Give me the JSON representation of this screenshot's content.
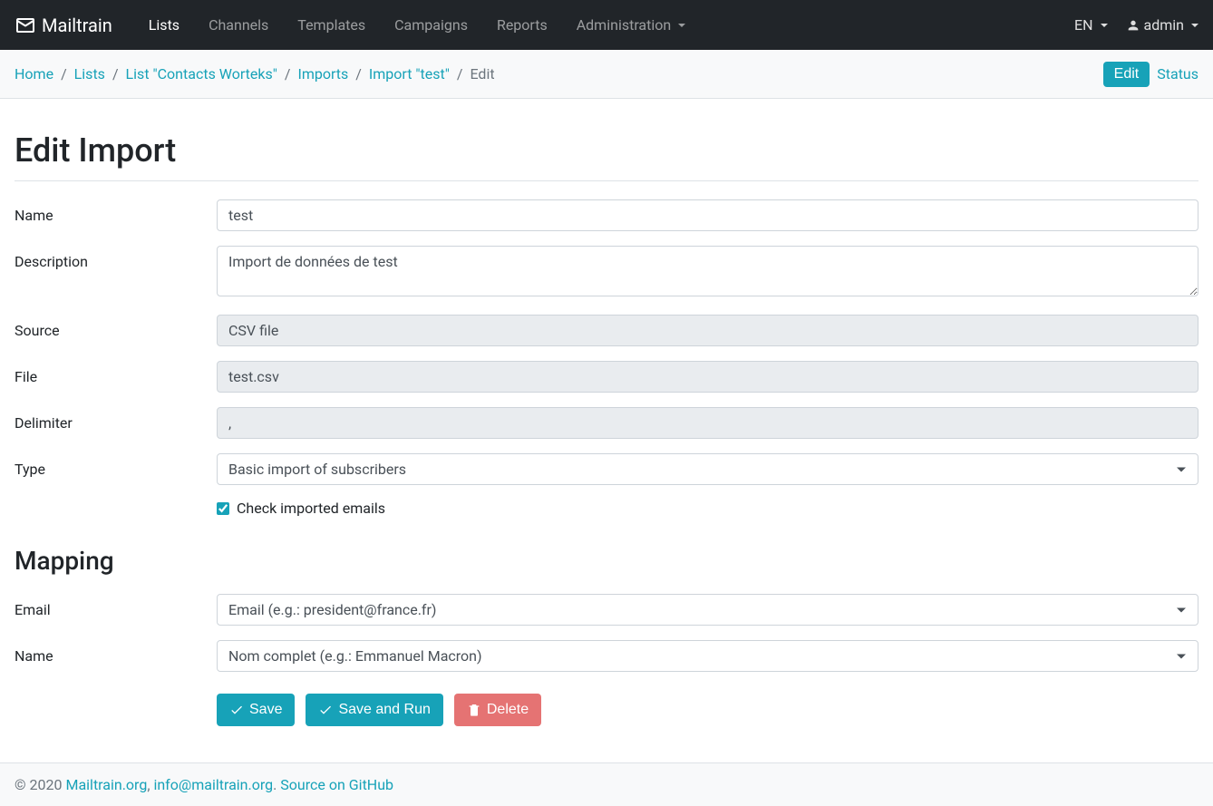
{
  "brand": "Mailtrain",
  "nav": {
    "items": [
      {
        "label": "Lists",
        "active": true
      },
      {
        "label": "Channels"
      },
      {
        "label": "Templates"
      },
      {
        "label": "Campaigns"
      },
      {
        "label": "Reports"
      },
      {
        "label": "Administration",
        "dropdown": true
      }
    ],
    "right": {
      "lang": "EN",
      "user": "admin"
    }
  },
  "breadcrumb": [
    {
      "label": "Home",
      "link": true
    },
    {
      "label": "Lists",
      "link": true
    },
    {
      "label": "List \"Contacts Worteks\"",
      "link": true
    },
    {
      "label": "Imports",
      "link": true
    },
    {
      "label": "Import \"test\"",
      "link": true
    },
    {
      "label": "Edit",
      "link": false
    }
  ],
  "tabs": {
    "edit": "Edit",
    "status": "Status"
  },
  "page": {
    "title": "Edit Import",
    "mapping_title": "Mapping"
  },
  "form": {
    "name_label": "Name",
    "name_value": "test",
    "description_label": "Description",
    "description_value": "Import de données de test",
    "source_label": "Source",
    "source_value": "CSV file",
    "file_label": "File",
    "file_value": "test.csv",
    "delimiter_label": "Delimiter",
    "delimiter_value": ",",
    "type_label": "Type",
    "type_value": "Basic import of subscribers",
    "check_emails_label": "Check imported emails",
    "check_emails_checked": true
  },
  "mapping": {
    "email_label": "Email",
    "email_value": "Email (e.g.: president@france.fr)",
    "name_label": "Name",
    "name_value": "Nom complet (e.g.: Emmanuel Macron)"
  },
  "buttons": {
    "save": "Save",
    "save_run": "Save and Run",
    "delete": "Delete"
  },
  "footer": {
    "copyright": "© 2020 ",
    "link1": "Mailtrain.org",
    "sep1": ", ",
    "link2": "info@mailtrain.org",
    "sep2": ". ",
    "link3": "Source on GitHub"
  }
}
